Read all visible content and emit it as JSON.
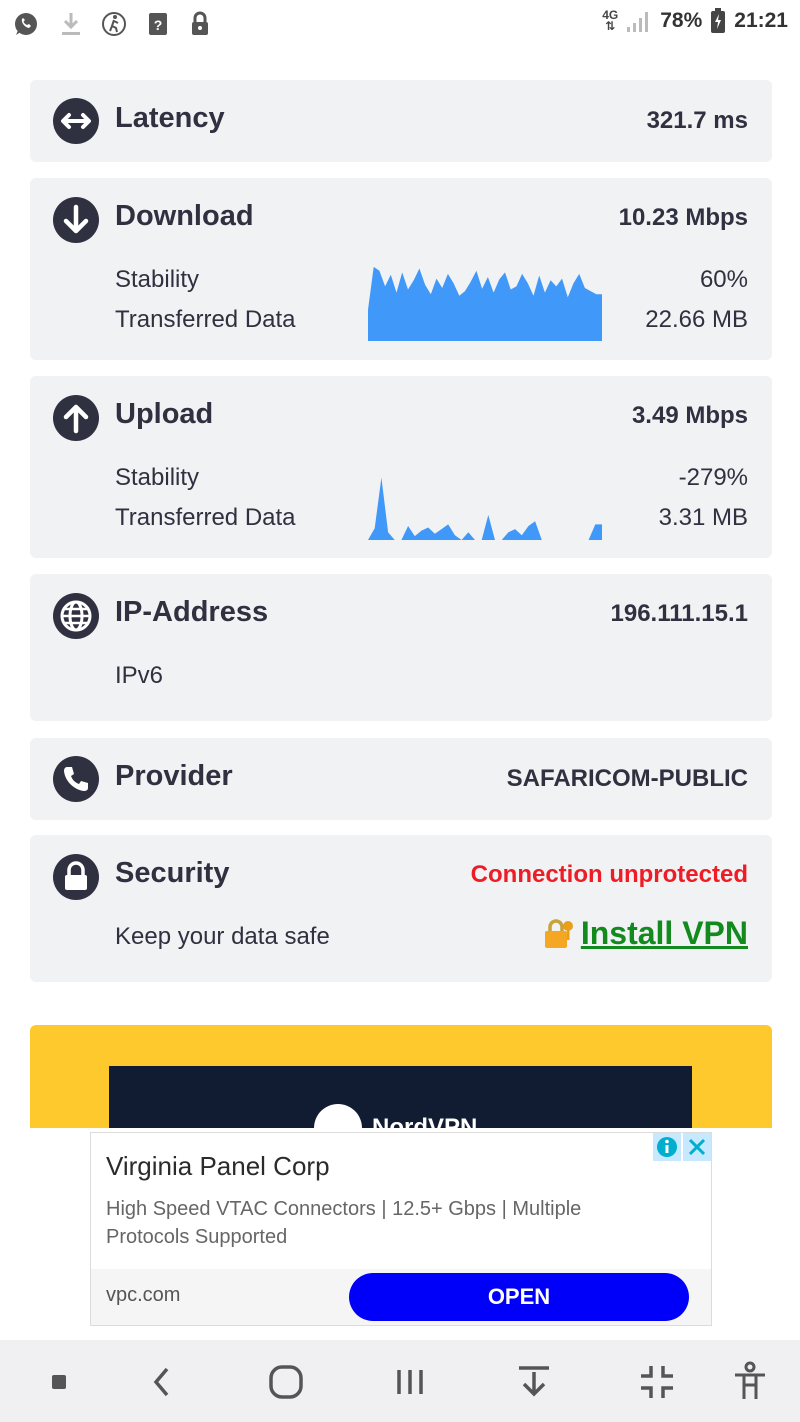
{
  "status_bar": {
    "network_top": "4G",
    "battery": "78%",
    "time": "21:21",
    "icons": [
      "whatsapp-icon",
      "download-icon",
      "run-icon",
      "unknown-file-icon",
      "lock-icon"
    ]
  },
  "latency": {
    "title": "Latency",
    "value": "321.7 ms"
  },
  "download": {
    "title": "Download",
    "value": "10.23 Mbps",
    "stability_label": "Stability",
    "stability_value": "60%",
    "transferred_label": "Transferred Data",
    "transferred_value": "22.66 MB",
    "graph_color": "#4098f8",
    "graph": [
      0.4,
      0.95,
      0.9,
      0.7,
      0.85,
      0.62,
      0.88,
      0.66,
      0.78,
      0.93,
      0.72,
      0.6,
      0.8,
      0.68,
      0.86,
      0.74,
      0.58,
      0.64,
      0.76,
      0.9,
      0.67,
      0.82,
      0.62,
      0.79,
      0.88,
      0.66,
      0.7,
      0.86,
      0.74,
      0.58,
      0.84,
      0.62,
      0.78,
      0.7,
      0.8,
      0.56,
      0.74,
      0.86,
      0.68,
      0.64,
      0.6,
      0.6
    ]
  },
  "upload": {
    "title": "Upload",
    "value": "3.49 Mbps",
    "stability_label": "Stability",
    "stability_value": "-279%",
    "transferred_label": "Transferred Data",
    "transferred_value": "3.31 MB",
    "graph_color": "#4098f8",
    "graph": [
      0.0,
      0.15,
      0.8,
      0.1,
      0.0,
      0.0,
      0.18,
      0.05,
      0.12,
      0.16,
      0.08,
      0.14,
      0.2,
      0.06,
      0.0,
      0.1,
      0.0,
      0.0,
      0.32,
      0.0,
      0.0,
      0.1,
      0.14,
      0.06,
      0.18,
      0.24,
      0.0,
      0.0,
      0.0,
      0.0,
      0.0,
      0.0,
      0.0,
      0.0,
      0.2,
      0.2
    ]
  },
  "ip": {
    "title": "IP-Address",
    "value": "196.111.15.1",
    "type": "IPv6"
  },
  "provider": {
    "title": "Provider",
    "value": "SAFARICOM-PUBLIC"
  },
  "security": {
    "title": "Security",
    "status": "Connection unprotected",
    "status_color": "#ee1c24",
    "subtitle": "Keep your data safe",
    "vpn_label": "Install VPN",
    "vpn_color": "#128a1e"
  },
  "nord_ad": {
    "brand": "NordVPN"
  },
  "banner_ad": {
    "title": "Virginia Panel Corp",
    "description": "High Speed VTAC Connectors | 12.5+ Gbps | Multiple Protocols Supported",
    "url": "vpc.com",
    "cta": "OPEN"
  },
  "navbar": {
    "buttons": [
      "square-icon",
      "back-icon",
      "home-icon",
      "recents-icon",
      "notification-pulldown-icon",
      "collapse-icon",
      "accessibility-icon"
    ]
  }
}
